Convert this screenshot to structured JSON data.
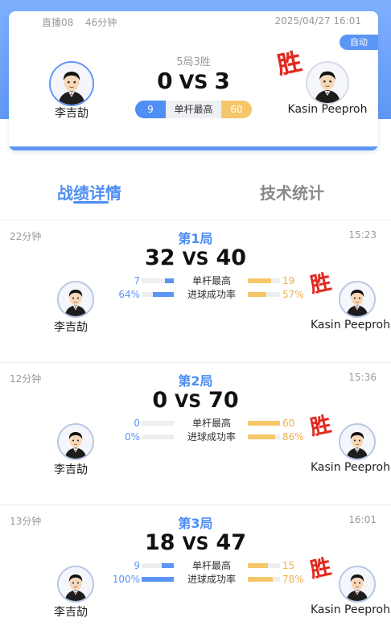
{
  "summary": {
    "live_label": "直播08",
    "duration": "46分钟",
    "datetime": "2025/04/27 16:01",
    "auto_badge": "自动",
    "format": "5局3胜",
    "score_left": "0",
    "vs": "VS",
    "score_right": "3",
    "high_break_label": "单杆最高",
    "high_break_left": "9",
    "high_break_right": "60",
    "player_left": "李吉劼",
    "player_right": "Kasin Peeproh",
    "win_stamp": "胜"
  },
  "tabs": [
    {
      "label": "战绩详情",
      "active": true
    },
    {
      "label": "技术统计",
      "active": false
    }
  ],
  "frames": [
    {
      "duration": "22分钟",
      "time": "15:23",
      "title": "第1局",
      "score_left": "32",
      "vs": "VS",
      "score_right": "40",
      "player_left": "李吉劼",
      "player_right": "Kasin Peeproh",
      "win_stamp": "胜",
      "stats": [
        {
          "label": "单杆最高",
          "left": "7",
          "right": "19",
          "left_fill": 0.27,
          "right_fill": 0.73
        },
        {
          "label": "进球成功率",
          "left": "64%",
          "right": "57%",
          "left_fill": 0.64,
          "right_fill": 0.57
        }
      ]
    },
    {
      "duration": "12分钟",
      "time": "15:36",
      "title": "第2局",
      "score_left": "0",
      "vs": "VS",
      "score_right": "70",
      "player_left": "李吉劼",
      "player_right": "Kasin Peeproh",
      "win_stamp": "胜",
      "stats": [
        {
          "label": "单杆最高",
          "left": "0",
          "right": "60",
          "left_fill": 0.0,
          "right_fill": 1.0
        },
        {
          "label": "进球成功率",
          "left": "0%",
          "right": "86%",
          "left_fill": 0.0,
          "right_fill": 0.86
        }
      ]
    },
    {
      "duration": "13分钟",
      "time": "16:01",
      "title": "第3局",
      "score_left": "18",
      "vs": "VS",
      "score_right": "47",
      "player_left": "李吉劼",
      "player_right": "Kasin Peeproh",
      "win_stamp": "胜",
      "stats": [
        {
          "label": "单杆最高",
          "left": "9",
          "right": "15",
          "left_fill": 0.38,
          "right_fill": 0.62
        },
        {
          "label": "进球成功率",
          "left": "100%",
          "right": "78%",
          "left_fill": 1.0,
          "right_fill": 0.78
        }
      ]
    }
  ],
  "colors": {
    "accent_blue": "#4f8ef2",
    "accent_gold": "#f5c76a",
    "win_red": "#e0281e"
  },
  "icons": {
    "avatar": "player-avatar-icon"
  }
}
